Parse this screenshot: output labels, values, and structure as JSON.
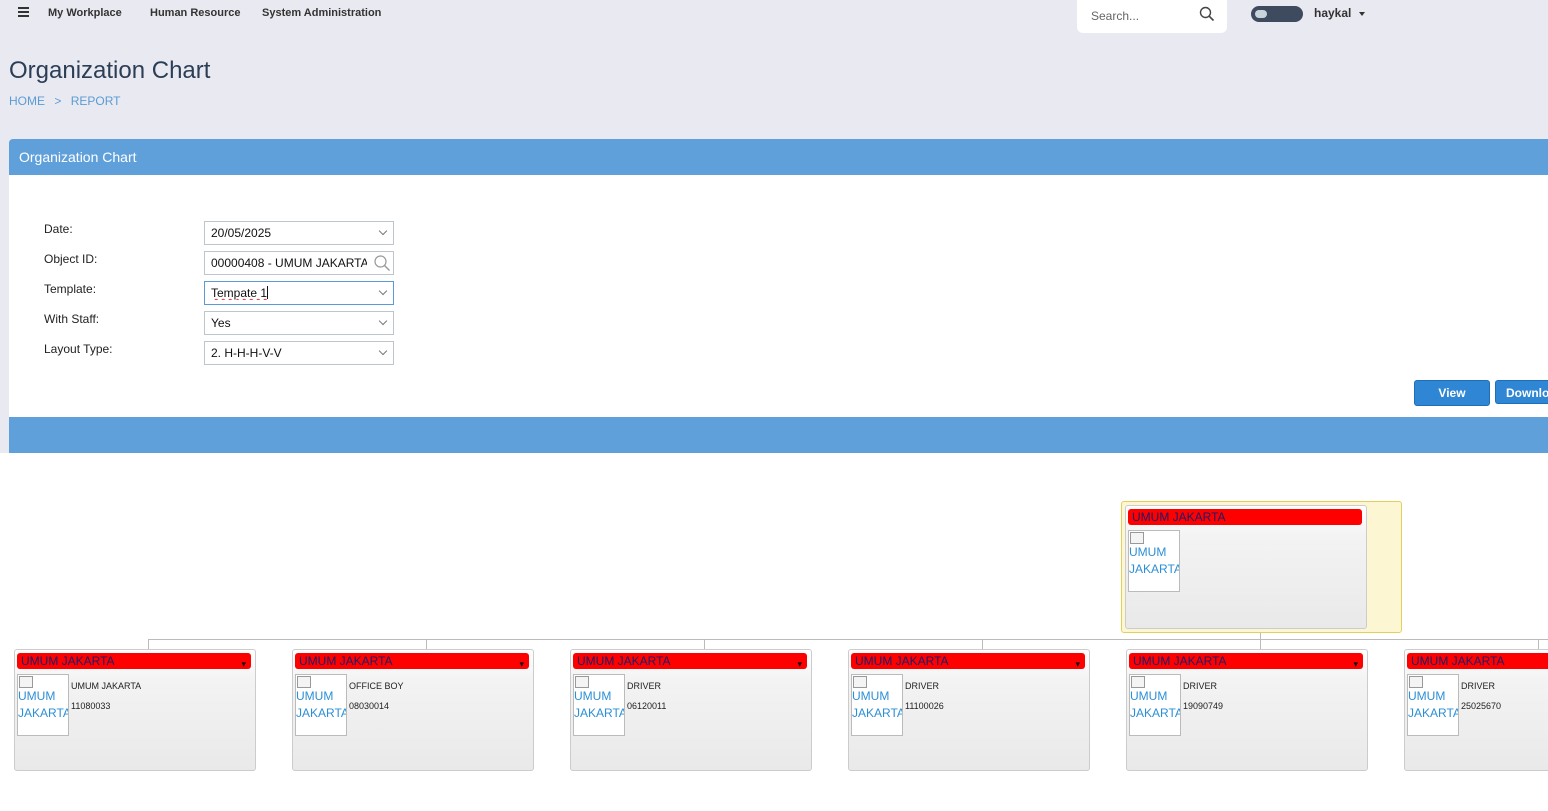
{
  "nav": {
    "items": [
      "My Workplace",
      "Human Resource",
      "System Administration"
    ],
    "search_placeholder": "Search...",
    "user_name": "haykal"
  },
  "page": {
    "title": "Organization Chart",
    "breadcrumb": [
      "HOME",
      ">",
      "REPORT"
    ]
  },
  "panel": {
    "title": "Organization Chart",
    "form": {
      "date_label": "Date:",
      "date_value": "20/05/2025",
      "object_label": "Object ID:",
      "object_value": "00000408 - UMUM JAKARTA",
      "template_label": "Template:",
      "template_value": "Tempate 1",
      "staff_label": "With Staff:",
      "staff_value": "Yes",
      "layout_label": "Layout Type:",
      "layout_value": "2. H-H-H-V-V"
    },
    "buttons": {
      "view": "View",
      "download": "Download"
    }
  },
  "org": {
    "root": {
      "title": "UMUM JAKARTA",
      "photo_alt": "UMUM JAKARTA"
    },
    "children": [
      {
        "title": "UMUM JAKARTA",
        "photo_alt": "UMUM JAKARTA",
        "position": "UMUM JAKARTA",
        "id": "11080033"
      },
      {
        "title": "UMUM JAKARTA",
        "photo_alt": "UMUM JAKARTA",
        "position": "OFFICE BOY",
        "id": "08030014"
      },
      {
        "title": "UMUM JAKARTA",
        "photo_alt": "UMUM JAKARTA",
        "position": "DRIVER",
        "id": "06120011"
      },
      {
        "title": "UMUM JAKARTA",
        "photo_alt": "UMUM JAKARTA",
        "position": "DRIVER",
        "id": "11100026"
      },
      {
        "title": "UMUM JAKARTA",
        "photo_alt": "UMUM JAKARTA",
        "position": "DRIVER",
        "id": "19090749"
      },
      {
        "title": "UMUM JAKARTA",
        "photo_alt": "UMUM JAKARTA",
        "position": "DRIVER",
        "id": "25025670"
      }
    ]
  },
  "colors": {
    "accent": "#5fa0db",
    "button": "#2e86d4",
    "node_title": "#ff0000"
  }
}
